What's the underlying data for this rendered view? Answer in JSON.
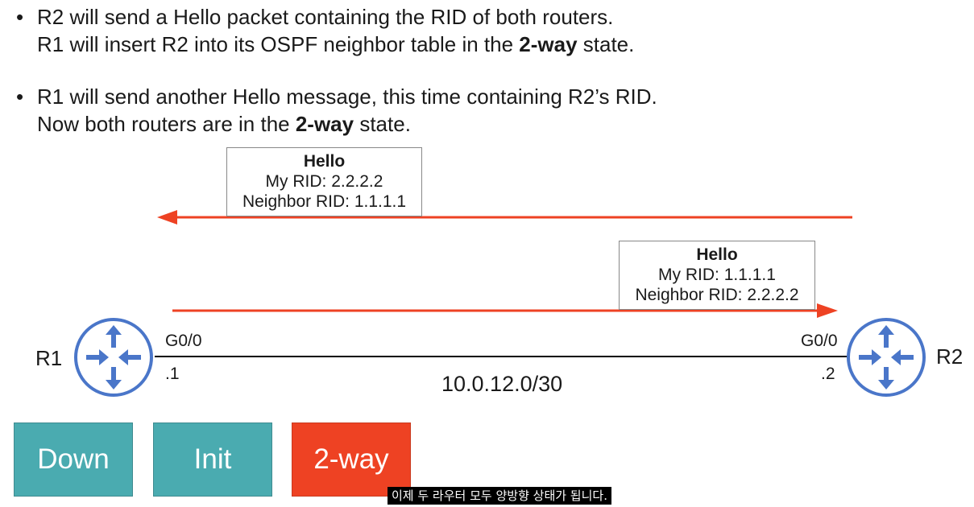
{
  "bullets": [
    {
      "line1": "R2 will send a Hello packet containing the RID of both routers.",
      "line2_pre": "R1 will insert R2 into its OSPF neighbor table in the ",
      "line2_bold": "2-way",
      "line2_post": " state."
    },
    {
      "line1": "R1 will send another Hello message, this time containing R2’s RID.",
      "line2_pre": "Now both routers are in the ",
      "line2_bold": "2-way",
      "line2_post": " state."
    }
  ],
  "bullet_symbol": "•",
  "hello_packets": [
    {
      "title": "Hello",
      "my_rid": "My RID: 2.2.2.2",
      "neighbor_rid": "Neighbor RID: 1.1.1.1",
      "direction": "R2 to R1"
    },
    {
      "title": "Hello",
      "my_rid": "My RID: 1.1.1.1",
      "neighbor_rid": "Neighbor RID: 2.2.2.2",
      "direction": "R1 to R2"
    }
  ],
  "routers": {
    "r1": {
      "name": "R1",
      "interface": "G0/0",
      "ip": ".1"
    },
    "r2": {
      "name": "R2",
      "interface": "G0/0",
      "ip": ".2"
    }
  },
  "network": "10.0.12.0/30",
  "states": [
    {
      "label": "Down",
      "color": "#4aabb0"
    },
    {
      "label": "Init",
      "color": "#4aabb0"
    },
    {
      "label": "2-way",
      "color": "#ee4223"
    }
  ],
  "subtitle": "이제 두 라우터 모두 양방향 상태가 됩니다.",
  "colors": {
    "arrow": "#ee4223",
    "router": "#4a76c9",
    "link": "#000000"
  }
}
